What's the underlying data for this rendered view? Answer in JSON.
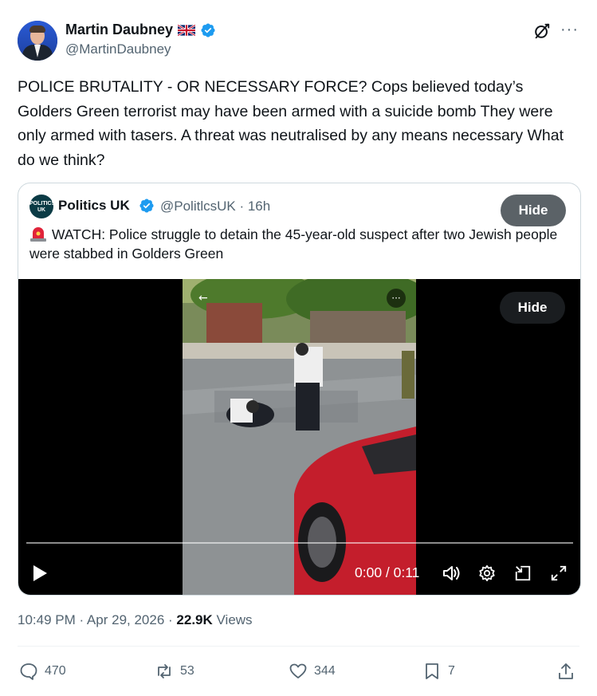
{
  "author": {
    "name": "Martin Daubney",
    "handle": "@MartinDaubney"
  },
  "tweet": {
    "text": "POLICE BRUTALITY - OR NECESSARY FORCE? Cops believed today’s Golders Green terrorist may have been armed with a suicide bomb  They were only armed with tasers. A threat was neutralised by any means necessary  What do we think?"
  },
  "quote": {
    "avatar_text": "POLITICS UK",
    "name": "Politics UK",
    "handle_time": "@PolitlcsUK · 16h",
    "hide_label": "Hide",
    "text": "WATCH: Police struggle to detain the 45-year-old suspect after two Jewish people were stabbed in Golders Green",
    "video": {
      "hide_label": "Hide",
      "time": "0:00 / 0:11",
      "progress": 0
    }
  },
  "meta": {
    "time": "10:49 PM · Apr 29, 2026 · ",
    "views_count": "22.9K",
    "views_label": " Views"
  },
  "actions": {
    "replies": "470",
    "reposts": "53",
    "likes": "344",
    "bookmarks": "7"
  },
  "colors": {
    "verified": "#1d9bf0",
    "text_secondary": "#536471",
    "border": "#cfd9de"
  }
}
